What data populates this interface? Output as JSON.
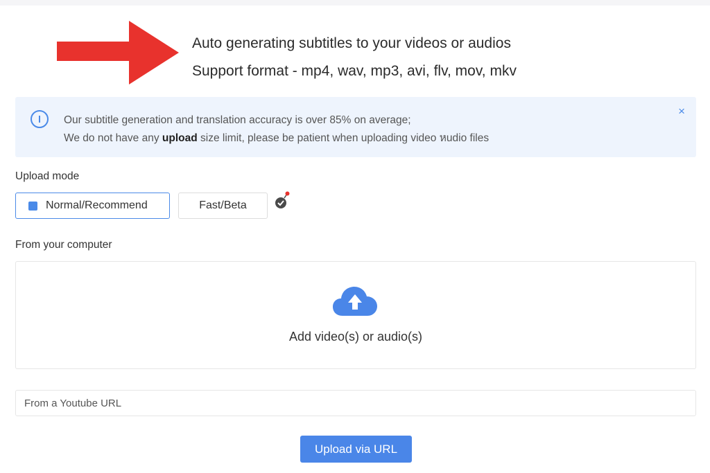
{
  "headline": {
    "line1": "Auto generating subtitles to your videos or audios",
    "line2": "Support format - mp4, wav, mp3, avi, flv, mov, mkv"
  },
  "notice": {
    "line1": "Our subtitle generation and translation accuracy is over 85% on average;",
    "line2_before": "We do not have any ",
    "line2_bold": "upload",
    "line2_after": " size limit, please be patient when uploading video หudio files",
    "close_label": "×"
  },
  "upload_mode": {
    "label": "Upload mode",
    "options": [
      {
        "label": "Normal/Recommend",
        "selected": true
      },
      {
        "label": "Fast/Beta",
        "selected": false
      }
    ]
  },
  "computer": {
    "label": "From your computer",
    "drop_text": "Add video(s) or audio(s)"
  },
  "youtube": {
    "placeholder": "From a Youtube URL"
  },
  "upload_button": {
    "label": "Upload via URL"
  },
  "colors": {
    "accent": "#4a86e8",
    "arrow": "#e8322d",
    "notice_bg": "#eef4fd"
  },
  "icons": {
    "arrow": "red-arrow-right-icon",
    "info": "info-circle-icon",
    "close": "close-icon",
    "badge": "check-badge-icon",
    "cloud": "cloud-upload-icon"
  }
}
